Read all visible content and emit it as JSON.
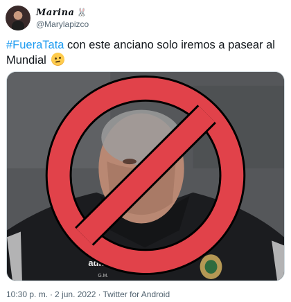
{
  "user": {
    "display_name": "Marina",
    "handle": "@Marylapizco",
    "name_icon": "bunny-icon",
    "avatar_icon": "avatar-photo"
  },
  "tweet": {
    "hashtag": "#FueraTata",
    "text": " con este anciano solo iremos a pasear al Mundial ",
    "emoji_icon": "face-with-rolling-eyes-icon"
  },
  "media": {
    "icon": "prohibited-sign-icon",
    "shirt_brand": "adidas",
    "shirt_initials": "G.M."
  },
  "meta": {
    "time": "10:30 p. m.",
    "separator": "·",
    "date": "2 jun. 2022",
    "source": "Twitter for Android"
  },
  "colors": {
    "hashtag": "#1d9bf0",
    "text": "#0f1419",
    "muted": "#536471",
    "prohibited_sign": "#e1424a"
  }
}
